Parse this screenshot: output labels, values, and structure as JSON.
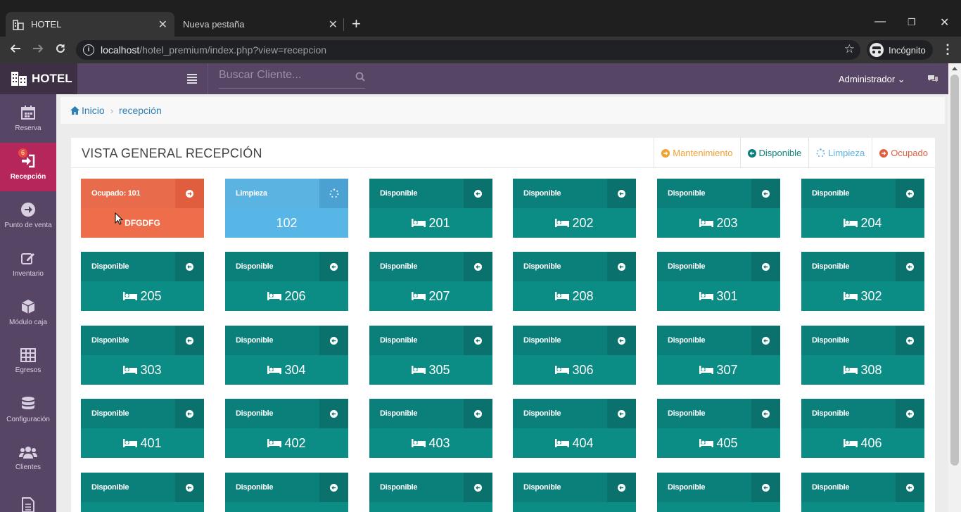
{
  "browser": {
    "tabs": [
      {
        "title": "HOTEL",
        "active": true,
        "icon": "hotel-favicon"
      },
      {
        "title": "Nueva pestaña",
        "active": false
      }
    ],
    "close_glyph": "✕",
    "new_tab_glyph": "+",
    "url_host": "localhost",
    "url_path": "/hotel_premium/index.php?view=recepcion",
    "incognito_label": "Incógnito",
    "window_controls": [
      "—",
      "❐",
      "✕"
    ]
  },
  "header": {
    "brand": "HOTEL",
    "search_placeholder": "Buscar Cliente...",
    "user_menu": "Administrador ⌄",
    "colors": {
      "header": "#564564",
      "brand_bg": "#3d3045"
    }
  },
  "sidebar": {
    "items": [
      {
        "label": "Reserva",
        "icon": "calendar-icon",
        "active": false
      },
      {
        "label": "Recepción",
        "icon": "sign-in-icon",
        "active": true,
        "badge": "6"
      },
      {
        "label": "Punto de venta",
        "icon": "arrow-circle-icon",
        "active": false
      },
      {
        "label": "Inventario",
        "icon": "edit-icon",
        "active": false
      },
      {
        "label": "Módulo caja",
        "icon": "cube-icon",
        "active": false
      },
      {
        "label": "Egresos",
        "icon": "table-icon",
        "active": false
      },
      {
        "label": "Configuración",
        "icon": "database-icon",
        "active": false
      },
      {
        "label": "Clientes",
        "icon": "users-icon",
        "active": false
      },
      {
        "label": "",
        "icon": "file-icon",
        "active": false
      }
    ],
    "active_color": "#b5265a"
  },
  "breadcrumb": {
    "home": "Inicio",
    "sep": "›",
    "current": "recepción"
  },
  "panel": {
    "title": "VISTA GENERAL RECEPCIÓN",
    "legend": [
      {
        "label": "Mantenimiento",
        "color": "#f0a030",
        "icon": "arrow-circle-right-icon"
      },
      {
        "label": "Disponible",
        "color": "#0b807a",
        "icon": "arrow-circle-left-icon"
      },
      {
        "label": "Limpieza",
        "color": "#5bb3e2",
        "icon": "spinner-icon"
      },
      {
        "label": "Ocupado",
        "color": "#e05e3e",
        "icon": "arrow-circle-right-icon"
      }
    ]
  },
  "rooms": [
    {
      "status": "Ocupado: 101",
      "type": "occ",
      "label": "DFGDFG"
    },
    {
      "status": "Limpieza",
      "type": "clean",
      "label": "102"
    },
    {
      "status": "Disponible",
      "type": "disp",
      "label": "201"
    },
    {
      "status": "Disponible",
      "type": "disp",
      "label": "202"
    },
    {
      "status": "Disponible",
      "type": "disp",
      "label": "203"
    },
    {
      "status": "Disponible",
      "type": "disp",
      "label": "204"
    },
    {
      "status": "Disponible",
      "type": "disp",
      "label": "205"
    },
    {
      "status": "Disponible",
      "type": "disp",
      "label": "206"
    },
    {
      "status": "Disponible",
      "type": "disp",
      "label": "207"
    },
    {
      "status": "Disponible",
      "type": "disp",
      "label": "208"
    },
    {
      "status": "Disponible",
      "type": "disp",
      "label": "301"
    },
    {
      "status": "Disponible",
      "type": "disp",
      "label": "302"
    },
    {
      "status": "Disponible",
      "type": "disp",
      "label": "303"
    },
    {
      "status": "Disponible",
      "type": "disp",
      "label": "304"
    },
    {
      "status": "Disponible",
      "type": "disp",
      "label": "305"
    },
    {
      "status": "Disponible",
      "type": "disp",
      "label": "306"
    },
    {
      "status": "Disponible",
      "type": "disp",
      "label": "307"
    },
    {
      "status": "Disponible",
      "type": "disp",
      "label": "308"
    },
    {
      "status": "Disponible",
      "type": "disp",
      "label": "401"
    },
    {
      "status": "Disponible",
      "type": "disp",
      "label": "402"
    },
    {
      "status": "Disponible",
      "type": "disp",
      "label": "403"
    },
    {
      "status": "Disponible",
      "type": "disp",
      "label": "404"
    },
    {
      "status": "Disponible",
      "type": "disp",
      "label": "405"
    },
    {
      "status": "Disponible",
      "type": "disp",
      "label": "406"
    },
    {
      "status": "Disponible",
      "type": "disp",
      "label": ""
    },
    {
      "status": "Disponible",
      "type": "disp",
      "label": ""
    },
    {
      "status": "Disponible",
      "type": "disp",
      "label": ""
    },
    {
      "status": "Disponible",
      "type": "disp",
      "label": ""
    },
    {
      "status": "Disponible",
      "type": "disp",
      "label": ""
    },
    {
      "status": "Disponible",
      "type": "disp",
      "label": ""
    }
  ]
}
